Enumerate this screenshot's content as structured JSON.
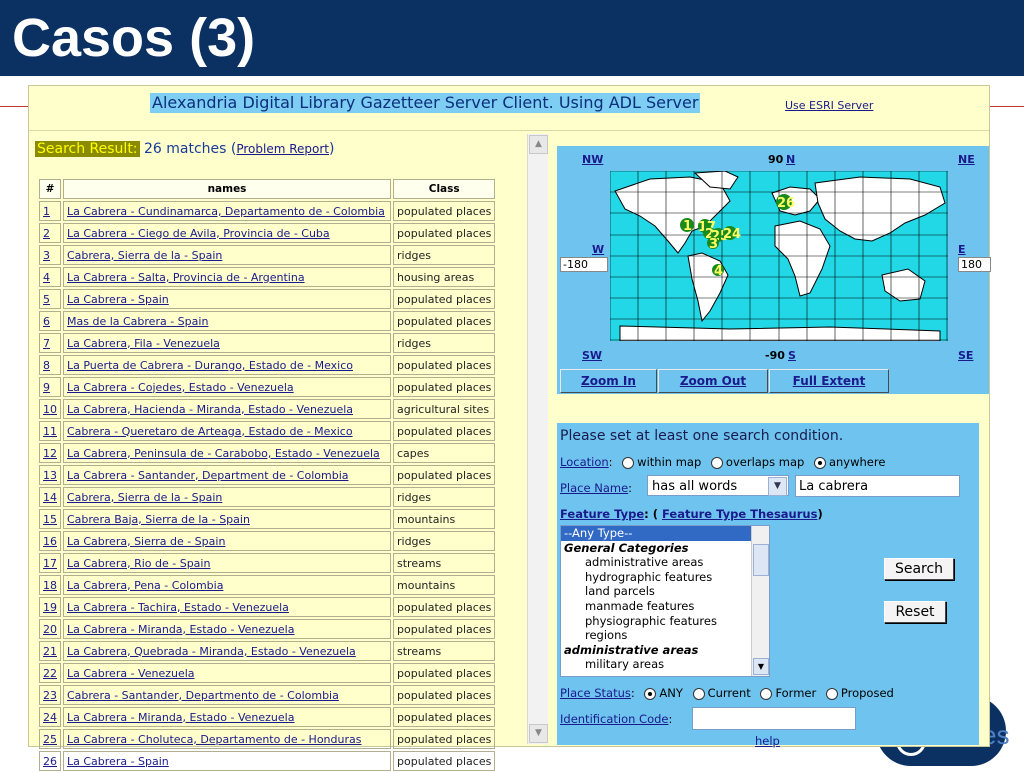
{
  "slide": {
    "title": "Casos (3)",
    "logo_text": "es"
  },
  "header": {
    "title": "Alexandria Digital Library Gazetteer Server Client. Using ADL Server",
    "esri_link": "Use ESRI Server"
  },
  "results": {
    "label": "Search Result:",
    "count": "26 matches",
    "open": " (",
    "problem_link": "Problem Report",
    "close": ")",
    "columns": [
      "#",
      "names",
      "Class"
    ],
    "rows": [
      [
        "1",
        "La Cabrera - Cundinamarca, Departamento de - Colombia",
        "populated places"
      ],
      [
        "2",
        "La Cabrera - Ciego de Avila, Provincia de - Cuba",
        "populated places"
      ],
      [
        "3",
        "Cabrera, Sierra de la - Spain",
        "ridges"
      ],
      [
        "4",
        "La Cabrera - Salta, Provincia de - Argentina",
        "housing areas"
      ],
      [
        "5",
        "La Cabrera - Spain",
        "populated places"
      ],
      [
        "6",
        "Mas de la Cabrera - Spain",
        "populated places"
      ],
      [
        "7",
        "La Cabrera, Fila - Venezuela",
        "ridges"
      ],
      [
        "8",
        "La Puerta de Cabrera - Durango, Estado de - Mexico",
        "populated places"
      ],
      [
        "9",
        "La Cabrera - Cojedes, Estado - Venezuela",
        "populated places"
      ],
      [
        "10",
        "La Cabrera, Hacienda - Miranda, Estado - Venezuela",
        "agricultural sites"
      ],
      [
        "11",
        "Cabrera - Queretaro de Arteaga, Estado de - Mexico",
        "populated places"
      ],
      [
        "12",
        "La Cabrera, Peninsula de - Carabobo, Estado - Venezuela",
        "capes"
      ],
      [
        "13",
        "La Cabrera - Santander, Department de - Colombia",
        "populated places"
      ],
      [
        "14",
        "Cabrera, Sierra de la - Spain",
        "ridges"
      ],
      [
        "15",
        "Cabrera Baja, Sierra de la - Spain",
        "mountains"
      ],
      [
        "16",
        "La Cabrera, Sierra de - Spain",
        "ridges"
      ],
      [
        "17",
        "La Cabrera, Rio de - Spain",
        "streams"
      ],
      [
        "18",
        "La Cabrera, Pena - Colombia",
        "mountains"
      ],
      [
        "19",
        "La Cabrera - Tachira, Estado - Venezuela",
        "populated places"
      ],
      [
        "20",
        "La Cabrera - Miranda, Estado - Venezuela",
        "populated places"
      ],
      [
        "21",
        "La Cabrera, Quebrada - Miranda, Estado - Venezuela",
        "streams"
      ],
      [
        "22",
        "La Cabrera - Venezuela",
        "populated places"
      ],
      [
        "23",
        "Cabrera - Santander, Departmento de - Colombia",
        "populated places"
      ],
      [
        "24",
        "La Cabrera - Miranda, Estado - Venezuela",
        "populated places"
      ],
      [
        "25",
        "La Cabrera - Choluteca, Departamento de - Honduras",
        "populated places"
      ],
      [
        "26",
        "La Cabrera - Spain",
        "populated places"
      ]
    ]
  },
  "map": {
    "nw": "NW",
    "n_value": "90",
    "n": "N",
    "ne": "NE",
    "w": "W",
    "w_value": "-180",
    "e": "E",
    "e_value": "180",
    "sw": "SW",
    "s_value": "-90",
    "s": "S",
    "se": "SE",
    "zoom_in": "Zoom In",
    "zoom_out": "Zoom Out",
    "full_extent": "Full Extent",
    "markers": [
      "26",
      "1",
      "17",
      "2",
      "25",
      "24",
      "3",
      "4"
    ]
  },
  "search": {
    "hint": "Please set at least one search condition.",
    "location_label": "Location",
    "location_options": [
      "within map",
      "overlaps map",
      "anywhere"
    ],
    "place_name_label": "Place Name",
    "place_name_mode": "has all words",
    "place_name_value": "La cabrera",
    "feature_type_label": "Feature Type",
    "feature_thesaurus": "Feature Type Thesaurus",
    "feature_items": [
      "--Any Type--",
      "General Categories",
      "administrative areas",
      "hydrographic features",
      "land parcels",
      "manmade features",
      "physiographic features",
      "regions",
      "administrative areas",
      "military areas"
    ],
    "place_status_label": "Place Status",
    "place_status_options": [
      "ANY",
      "Current",
      "Former",
      "Proposed"
    ],
    "id_code_label": "Identification Code",
    "search_button": "Search",
    "reset_button": "Reset",
    "help": "help"
  },
  "colors": {
    "slide_header": "#0b3163",
    "page_bg": "#ffffcc",
    "map_bg": "#6ec4ef",
    "ocean": "#22d8e6",
    "land": "#ffffff",
    "marker": "#1a8a1a"
  }
}
